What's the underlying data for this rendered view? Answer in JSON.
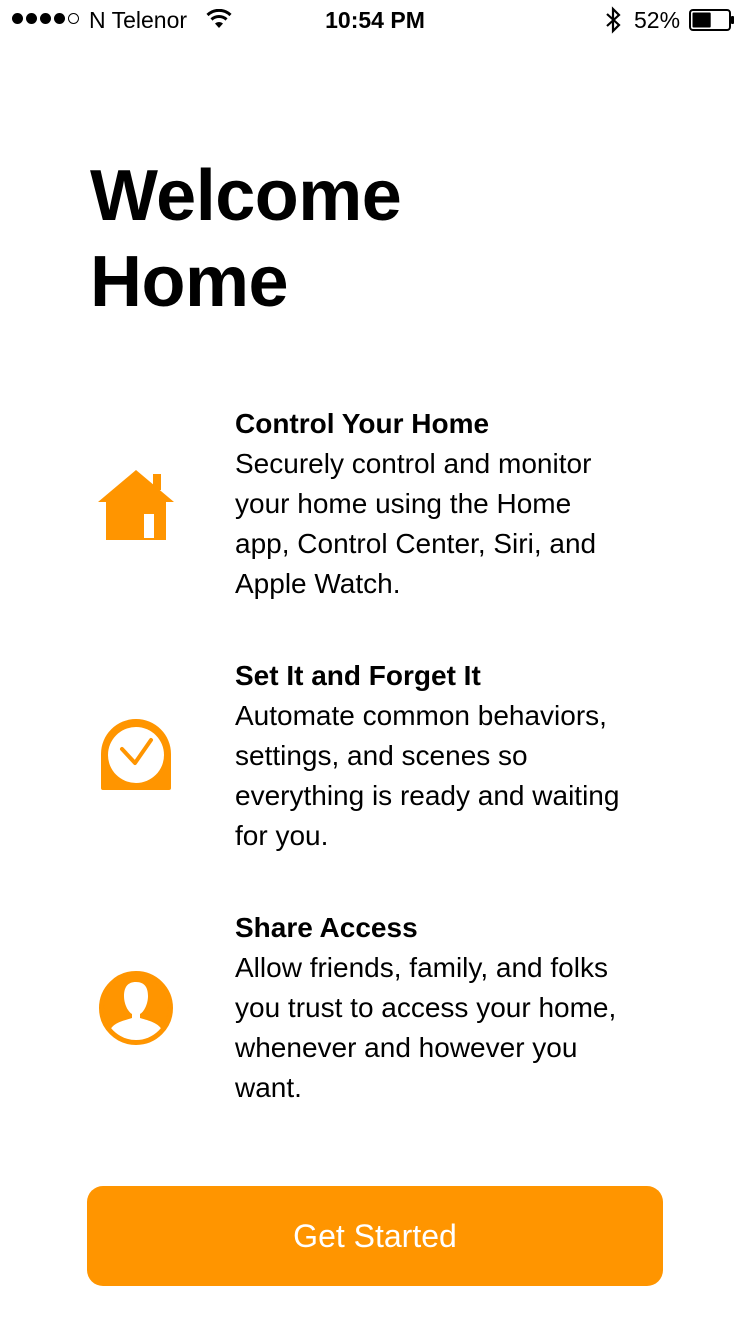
{
  "status_bar": {
    "carrier": "N Telenor",
    "time": "10:54 PM",
    "battery_percent": "52%",
    "signal_icon": "cellular-signal-icon",
    "wifi_icon": "wifi-icon",
    "bluetooth_icon": "bluetooth-icon",
    "battery_icon": "battery-icon",
    "battery_level": 0.52
  },
  "title": {
    "line1": "Welcome",
    "line2": "Home"
  },
  "features": [
    {
      "icon": "house-icon",
      "title": "Control Your Home",
      "lines": [
        "Securely control and monitor",
        "your home using the Home",
        "app, Control Center, Siri, and",
        "Apple Watch."
      ]
    },
    {
      "icon": "clock-icon",
      "title": "Set It and Forget It",
      "lines": [
        "Automate common behaviors,",
        "settings, and scenes so",
        "everything is ready and waiting",
        "for you."
      ]
    },
    {
      "icon": "person-icon",
      "title": "Share Access",
      "lines": [
        "Allow friends, family, and folks",
        "you trust to access your home,",
        "whenever and however you",
        "want."
      ]
    }
  ],
  "button": {
    "label": "Get Started"
  },
  "colors": {
    "accent": "#FF9500",
    "background": "#FFFFFF",
    "text": "#000000"
  }
}
